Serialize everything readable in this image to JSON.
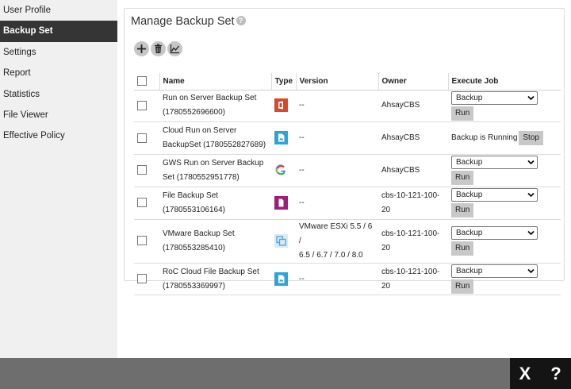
{
  "sidebar": {
    "items": [
      {
        "label": "User Profile"
      },
      {
        "label": "Backup Set"
      },
      {
        "label": "Settings"
      },
      {
        "label": "Report"
      },
      {
        "label": "Statistics"
      },
      {
        "label": "File Viewer"
      },
      {
        "label": "Effective Policy"
      }
    ],
    "active_index": 1
  },
  "panel": {
    "title": "Manage Backup Set",
    "help_glyph": "?"
  },
  "toolbar": {
    "icons": [
      "add-icon",
      "trash-icon",
      "chart-icon"
    ]
  },
  "table": {
    "columns": [
      "Name",
      "Type",
      "Version",
      "Owner",
      "Execute Job"
    ],
    "rows": [
      {
        "name_line1": "Run on Server Backup Set",
        "name_line2": "(1780552696600)",
        "type_icon": "office365-icon",
        "version_line1": "--",
        "version_line2": "",
        "owner_line1": "AhsayCBS",
        "owner_line2": "",
        "job": "select",
        "job_value": "Backup",
        "run_label": "Run"
      },
      {
        "name_line1": "Cloud Run on Server",
        "name_line2": "BackupSet (1780552827689)",
        "type_icon": "cloud-file-icon",
        "version_line1": "--",
        "version_line2": "",
        "owner_line1": "AhsayCBS",
        "owner_line2": "",
        "job": "running",
        "running_text": "Backup is Running",
        "stop_label": "Stop"
      },
      {
        "name_line1": "GWS Run on Server Backup",
        "name_line2": "Set (1780552951778)",
        "type_icon": "google-icon",
        "version_line1": "--",
        "version_line2": "",
        "owner_line1": "AhsayCBS",
        "owner_line2": "",
        "job": "select",
        "job_value": "Backup",
        "run_label": "Run"
      },
      {
        "name_line1": "File Backup Set",
        "name_line2": "(1780553106164)",
        "type_icon": "file-icon",
        "version_line1": "--",
        "version_line2": "",
        "owner_line1": "cbs-10-121-100-",
        "owner_line2": "20",
        "job": "select",
        "job_value": "Backup",
        "run_label": "Run"
      },
      {
        "name_line1": "VMware Backup Set",
        "name_line2": "(1780553285410)",
        "type_icon": "vmware-icon",
        "version_line1": "VMware ESXi 5.5 / 6 /",
        "version_line2": "6.5 / 6.7 / 7.0 / 8.0",
        "owner_line1": "cbs-10-121-100-",
        "owner_line2": "20",
        "job": "select",
        "job_value": "Backup",
        "run_label": "Run"
      },
      {
        "name_line1": "RoC Cloud File Backup Set",
        "name_line2": "(1780553369997)",
        "type_icon": "cloud-file-icon",
        "version_line1": "--",
        "version_line2": "",
        "owner_line1": "cbs-10-121-100-",
        "owner_line2": "20",
        "job": "select",
        "job_value": "Backup",
        "run_label": "Run"
      }
    ]
  },
  "footer": {
    "close_glyph": "X",
    "help_glyph": "?"
  },
  "colors": {
    "active_nav_bg": "#353535",
    "footer_bg": "#6e6e6e",
    "footer_box_bg": "#141414",
    "office_red": "#d64a2b",
    "cloud_blue": "#2ea3d8",
    "file_magenta": "#9e1c7a"
  }
}
